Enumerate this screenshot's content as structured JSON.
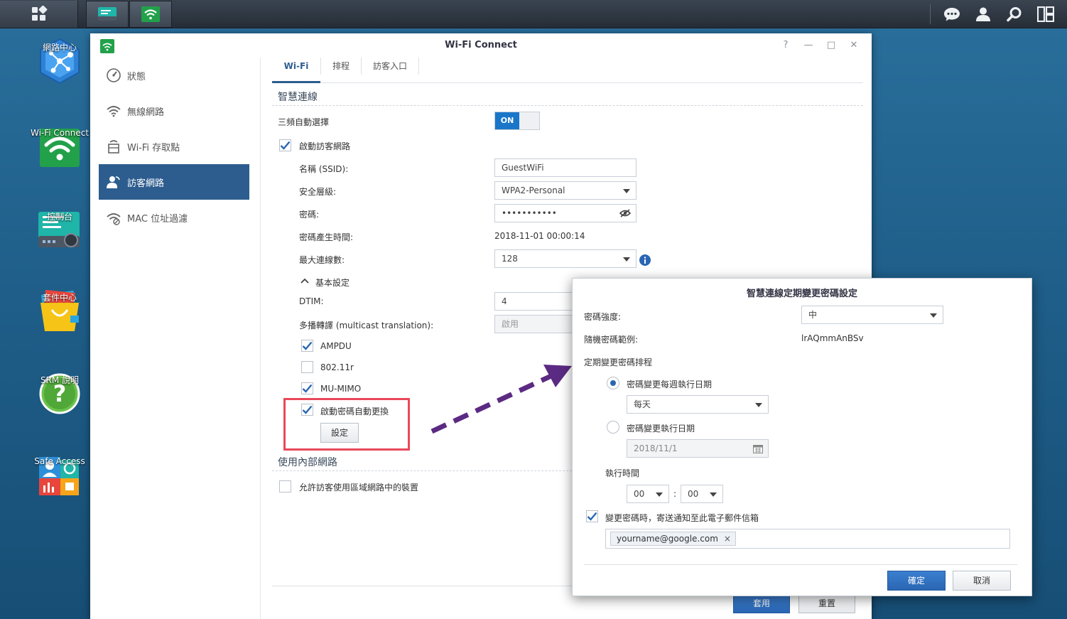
{
  "desktop": {
    "icons": [
      {
        "label": "網路中心"
      },
      {
        "label": "Wi-Fi Connect"
      },
      {
        "label": "控制台"
      },
      {
        "label": "套件中心"
      },
      {
        "label": "SRM 說明"
      },
      {
        "label": "Safe Access"
      }
    ]
  },
  "window": {
    "title": "Wi-Fi Connect",
    "controls": {
      "help": "?",
      "minimize": "—",
      "maximize": "□",
      "close": "✕"
    }
  },
  "sidebar": {
    "items": [
      {
        "label": "狀態"
      },
      {
        "label": "無線網路"
      },
      {
        "label": "Wi-Fi 存取點"
      },
      {
        "label": "訪客網路",
        "active": true
      },
      {
        "label": "MAC 位址過濾"
      }
    ]
  },
  "tabs": [
    {
      "label": "Wi-Fi",
      "active": true
    },
    {
      "label": "排程"
    },
    {
      "label": "訪客入口"
    }
  ],
  "smart": {
    "title": "智慧連線",
    "tri_band_label": "三頻自動選擇",
    "toggle_on": "ON",
    "enable_guest_label": "啟動訪客網路",
    "ssid_label": "名稱 (SSID):",
    "ssid_value": "GuestWiFi",
    "security_label": "安全層級:",
    "security_value": "WPA2-Personal",
    "password_label": "密碼:",
    "password_value": "•••••••••••",
    "pw_time_label": "密碼產生時間:",
    "pw_time_value": "2018-11-01 00:00:14",
    "max_conn_label": "最大連線數:",
    "max_conn_value": "128",
    "basic_label": "基本設定",
    "dtim_label": "DTIM:",
    "dtim_value": "4",
    "multicast_label": "多播轉譯 (multicast translation):",
    "multicast_value": "啟用",
    "ampdu_label": "AMPDU",
    "r80211_label": "802.11r",
    "mumimo_label": "MU-MIMO",
    "auto_pw_label": "啟動密碼自動更換",
    "settings_button": "設定"
  },
  "internal": {
    "title": "使用內部網路",
    "allow_label": "允許訪客使用區域網路中的裝置"
  },
  "footer": {
    "apply": "套用",
    "reset": "重置"
  },
  "dialog": {
    "title": "智慧連線定期變更密碼設定",
    "strength_label": "密碼強度:",
    "strength_value": "中",
    "example_label": "隨機密碼範例:",
    "example_value": "lrAQmmAnBSv",
    "schedule_label": "定期變更密碼排程",
    "weekly_label": "密碼變更每週執行日期",
    "weekly_value": "每天",
    "date_label": "密碼變更執行日期",
    "date_value": "2018/11/1",
    "time_label": "執行時間",
    "hour_value": "00",
    "colon": ":",
    "minute_value": "00",
    "notify_label": "變更密碼時，寄送通知至此電子郵件信箱",
    "email_value": "yourname@google.com",
    "email_remove": "×",
    "ok": "確定",
    "cancel": "取消"
  }
}
